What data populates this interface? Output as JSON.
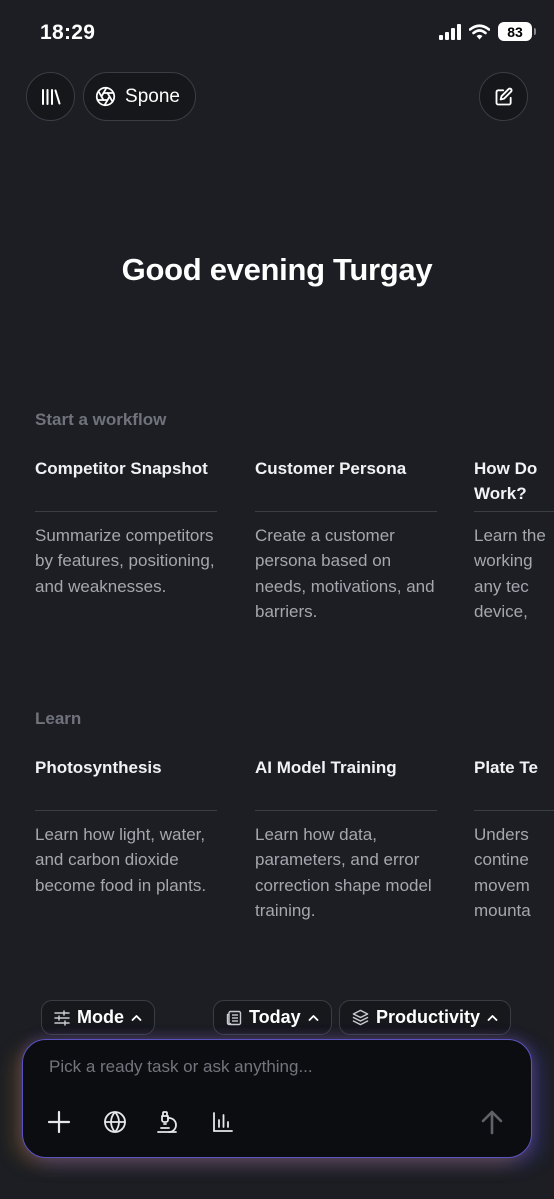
{
  "status_bar": {
    "time": "18:29",
    "battery": "83"
  },
  "header": {
    "assistant_name": "Spone"
  },
  "greeting": "Good evening Turgay",
  "workflows": {
    "title": "Start a workflow",
    "cards": [
      {
        "title": "Competitor Snapshot",
        "description": "Summarize competitors by features, positioning, and weaknesses."
      },
      {
        "title": "Customer Persona",
        "description": "Create a customer persona based on needs, motivations, and barriers."
      },
      {
        "title": "How Do Work?",
        "description": "Learn the working any tec device,"
      }
    ]
  },
  "learn": {
    "title": "Learn",
    "cards": [
      {
        "title": "Photosynthesis",
        "description": "Learn how light, water, and carbon dioxide become food in plants."
      },
      {
        "title": "AI Model Training",
        "description": "Learn how data, parameters, and error correction shape model training."
      },
      {
        "title": "Plate Te",
        "description": "Unders contine movem mounta"
      }
    ]
  },
  "chips": {
    "mode": "Mode",
    "today": "Today",
    "productivity": "Productivity"
  },
  "composer": {
    "placeholder": "Pick a ready task or ask anything..."
  }
}
